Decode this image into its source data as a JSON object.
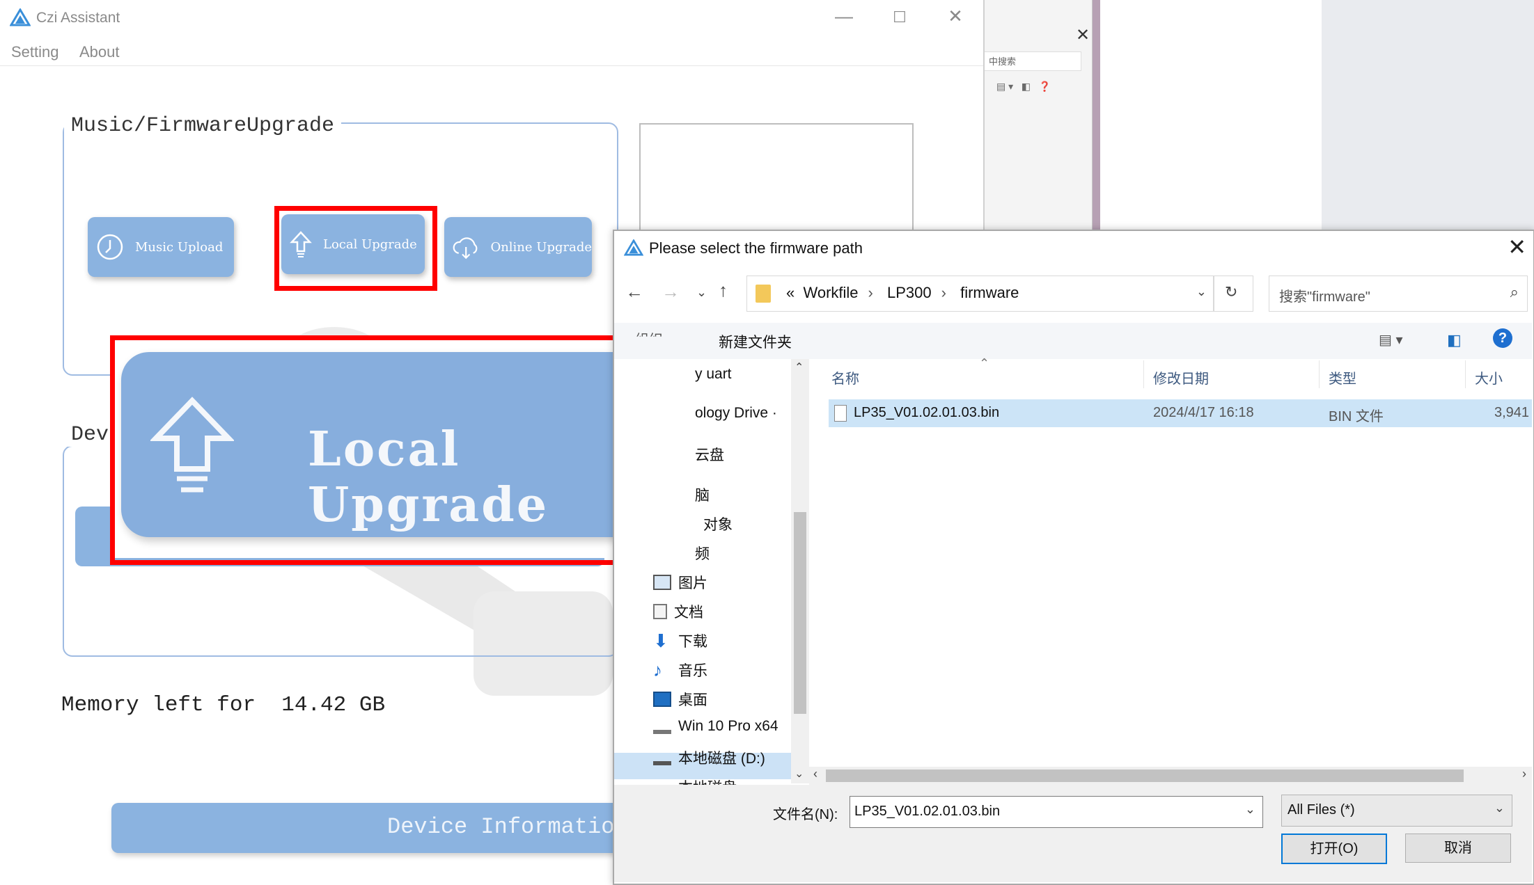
{
  "app": {
    "title": "Czi Assistant",
    "menu": [
      "Setting",
      "About"
    ],
    "group_title": "Music/FirmwareUpgrade",
    "group2_title_partial": "Dev",
    "buttons": {
      "music_upload": "Music Upload",
      "local_upgrade": "Local Upgrade",
      "online_upgrade": "Online Upgrade"
    },
    "zoom_label": "Local Upgrade",
    "memory_label": "Memory left for  14.42 GB",
    "device_info_button": "Device Information"
  },
  "background_window": {
    "search_placeholder": "中搜索"
  },
  "dialog": {
    "title": "Please select the firmware path",
    "breadcrumb_prefix": "«",
    "breadcrumb": [
      "Workfile",
      "LP300",
      "firmware"
    ],
    "search_placeholder": "搜索\"firmware\"",
    "toolbar": {
      "organize": "组织",
      "new_folder": "新建文件夹"
    },
    "nav_items": [
      {
        "label": "y uart",
        "icon": "none"
      },
      {
        "label": "ology Drive ·",
        "icon": "none"
      },
      {
        "label": "云盘",
        "icon": "none"
      },
      {
        "label": "脑",
        "icon": "none"
      },
      {
        "label": "对象",
        "icon": "none"
      },
      {
        "label": "频",
        "icon": "none"
      },
      {
        "label": "图片",
        "icon": "pictures-icon"
      },
      {
        "label": "文档",
        "icon": "documents-icon"
      },
      {
        "label": "下载",
        "icon": "download-icon"
      },
      {
        "label": "音乐",
        "icon": "music-icon"
      },
      {
        "label": "桌面",
        "icon": "desktop-icon"
      },
      {
        "label": "Win 10 Pro x64",
        "icon": "drive-icon"
      },
      {
        "label": "本地磁盘 (D:)",
        "icon": "drive-icon",
        "selected": true
      },
      {
        "label": "本地磁盘 (E:)",
        "icon": "drive-icon"
      }
    ],
    "columns": [
      "名称",
      "修改日期",
      "类型",
      "大小"
    ],
    "files": [
      {
        "name": "LP35_V01.02.01.03.bin",
        "modified": "2024/4/17 16:18",
        "type": "BIN 文件",
        "size": "3,941"
      }
    ],
    "filename_label": "文件名(N):",
    "filename_value": "LP35_V01.02.01.03.bin",
    "filetype_value": "All Files  (*)",
    "open_button": "打开(O)",
    "cancel_button": "取消"
  },
  "colors": {
    "button_blue": "#8bb3e0",
    "highlight_red": "#ff0000",
    "selection_blue": "#cce4f7"
  }
}
